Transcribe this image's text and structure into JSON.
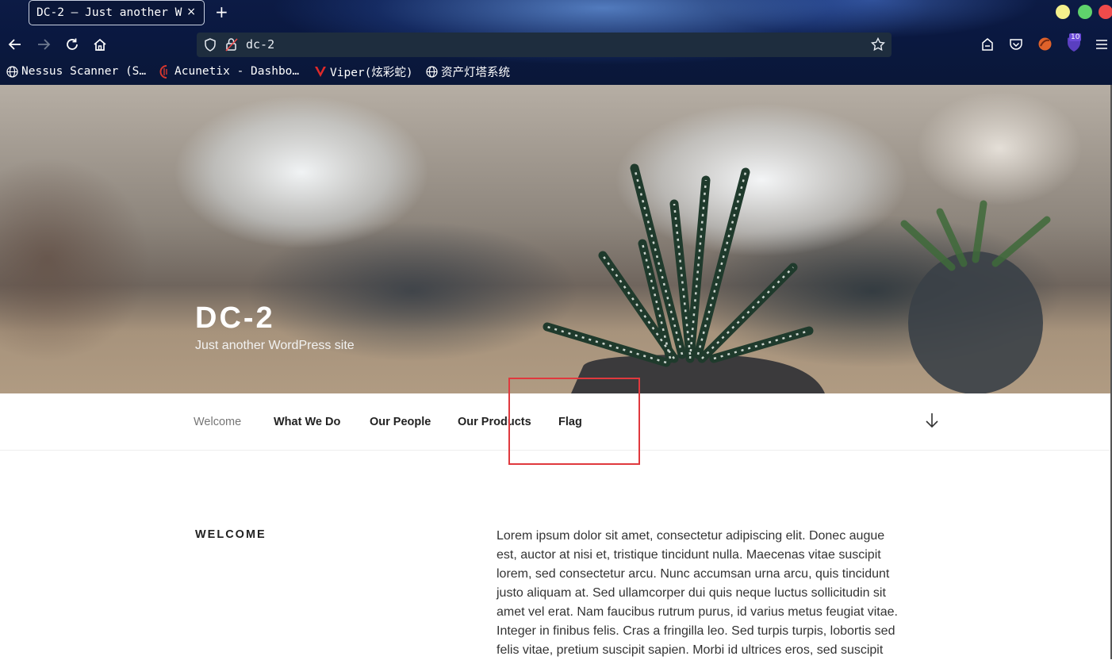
{
  "browser": {
    "tab_title": "DC-2 — Just another W",
    "tab_close": "×",
    "new_tab": "+",
    "url": "dc-2",
    "extension_badge": "10",
    "bookmarks": [
      {
        "label": "Nessus Scanner (S…",
        "icon": "globe-icon"
      },
      {
        "label": "Acunetix - Dashbo…",
        "icon": "acunetix-icon"
      },
      {
        "label": "Viper(炫彩蛇)",
        "icon": "viper-icon"
      },
      {
        "label": "资产灯塔系统",
        "icon": "globe-icon"
      }
    ],
    "window_colors": [
      "#f4f08c",
      "#5fd36c",
      "#ef4b4b"
    ]
  },
  "site": {
    "title": "DC-2",
    "description": "Just another WordPress site",
    "menu": [
      "Welcome",
      "What We Do",
      "Our People",
      "Our Products",
      "Flag"
    ],
    "current_menu": "Welcome"
  },
  "content": {
    "heading": "WELCOME",
    "lines": [
      "Lorem ipsum dolor sit amet, consectetur adipiscing elit. Donec augue",
      "est, auctor at nisi et, tristique tincidunt nulla. Maecenas vitae suscipit",
      "lorem, sed consectetur arcu. Nunc accumsan urna arcu, quis tincidunt",
      "justo aliquam at. Sed ullamcorper dui quis neque luctus sollicitudin sit",
      "amet vel erat. Nam faucibus rutrum purus, id varius metus feugiat vitae.",
      "Integer in finibus felis. Cras a fringilla leo. Sed turpis turpis, lobortis sed",
      "felis vitae, pretium suscipit sapien. Morbi id ultrices eros, sed suscipit"
    ]
  },
  "annotation_color": "#e0393e"
}
